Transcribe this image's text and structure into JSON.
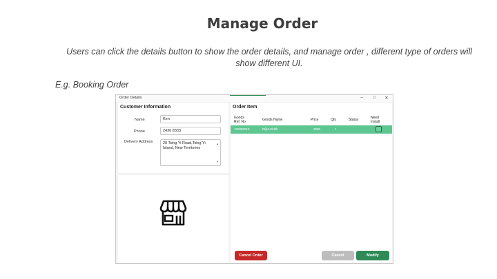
{
  "slide": {
    "title": "Manage Order",
    "description": "Users can click the  details button to show the order details, and manage order , different type of orders will show different UI.",
    "example_label": "E.g. Booking Order"
  },
  "window": {
    "title": "Order Details",
    "controls": {
      "minimize": "–",
      "maximize": "□",
      "close": "✕"
    }
  },
  "customer": {
    "section_title": "Customer Information",
    "name_label": "Name",
    "name_value": "Ken",
    "phone_label": "Phone",
    "phone_value": "2436 8333",
    "address_label": "Delivery Address",
    "address_value": "20 Tsing Yi Road,Tsing Yi Island, New Territories",
    "icon": "store-icon"
  },
  "order": {
    "section_title": "Order Item",
    "columns": {
      "ref": "Goods Ref. No",
      "name": "Goods Name",
      "price": "Price",
      "qty": "Qty",
      "status": "Status",
      "install": "Need Install"
    },
    "rows": [
      {
        "ref": "100000018",
        "name": "Dfjkn4rlrkfh",
        "price": "3000",
        "qty": "1",
        "status": "",
        "install_checked": false
      }
    ]
  },
  "buttons": {
    "cancel_order": "Cancel Order",
    "cancel": "Cancel",
    "modify": "Modify"
  },
  "colors": {
    "row_highlight": "#5dc691",
    "cancel_order": "#c62828",
    "cancel_disabled": "#bdbdbd",
    "modify": "#2e8b57"
  }
}
